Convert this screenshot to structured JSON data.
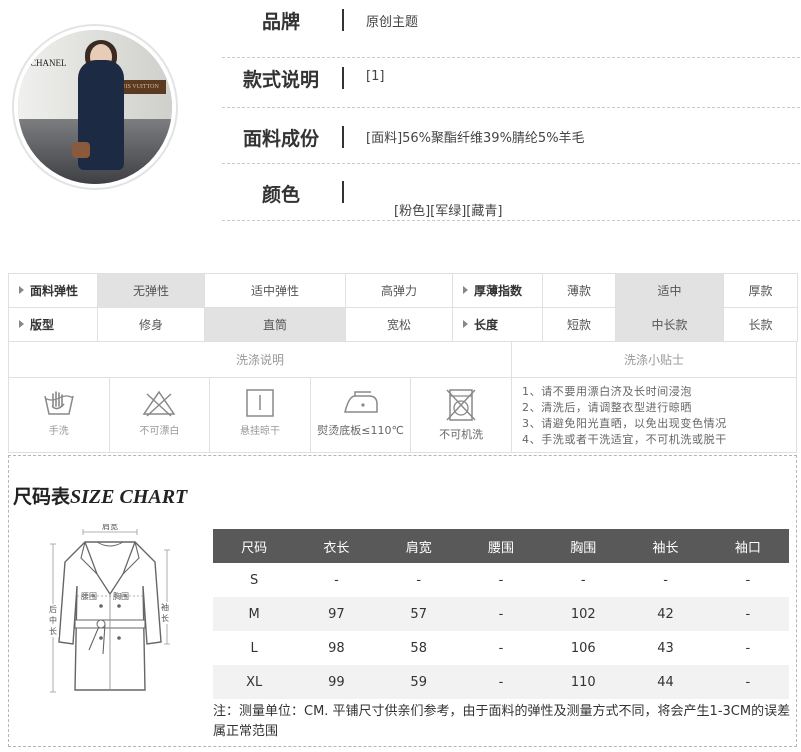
{
  "product": {
    "avatar_signs": [
      "CHANEL",
      "LOUIS VUITTON"
    ],
    "rows": [
      {
        "label": "品牌",
        "value": "原创主题"
      },
      {
        "label": "款式说明",
        "value": "[1]"
      },
      {
        "label": "面料成份",
        "value": "[面料]56%聚酯纤维39%腈纶5%羊毛"
      },
      {
        "label": "颜色",
        "value": "[粉色][军绿][藏青]"
      }
    ]
  },
  "attributes": {
    "rows": [
      {
        "group1": {
          "label": "面料弹性",
          "options": [
            "无弹性",
            "适中弹性",
            "高弹力"
          ],
          "selected": 0
        },
        "group2": {
          "label": "厚薄指数",
          "options": [
            "薄款",
            "适中",
            "厚款"
          ],
          "selected": 1
        }
      },
      {
        "group1": {
          "label": "版型",
          "options": [
            "修身",
            "直筒",
            "宽松"
          ],
          "selected": 1
        },
        "group2": {
          "label": "长度",
          "options": [
            "短款",
            "中长款",
            "长款"
          ],
          "selected": 1
        }
      }
    ]
  },
  "washing": {
    "title": "洗涤说明",
    "tips_title": "洗涤小贴士",
    "icons": [
      {
        "icon": "hand-wash-icon",
        "label": "手洗"
      },
      {
        "icon": "no-bleach-icon",
        "label": "不可漂白"
      },
      {
        "icon": "hang-dry-icon",
        "label": "悬挂晾干"
      },
      {
        "icon": "iron-icon",
        "label": "熨烫底板≤110℃"
      },
      {
        "icon": "no-machine-wash-icon",
        "label": "不可机洗"
      }
    ],
    "tips": [
      "1、请不要用漂白济及长时间浸泡",
      "2、清洗后，请调整衣型进行晾晒",
      "3、请避免阳光直晒，以免出现变色情况",
      "4、手洗或者干洗适宜，不可机洗或脱干"
    ]
  },
  "size_chart": {
    "title_cn": "尺码表",
    "title_en": "SIZE CHART",
    "diagram_labels": {
      "shoulder": "肩宽",
      "chest": "胸围",
      "waist": "腰围",
      "length_left": "后中长",
      "sleeve_right": "袖长"
    },
    "headers": [
      "尺码",
      "衣长",
      "肩宽",
      "腰围",
      "胸围",
      "袖长",
      "袖口"
    ],
    "rows": [
      [
        "S",
        "-",
        "-",
        "-",
        "-",
        "-",
        "-"
      ],
      [
        "M",
        "97",
        "57",
        "-",
        "102",
        "42",
        "-"
      ],
      [
        "L",
        "98",
        "58",
        "-",
        "106",
        "43",
        "-"
      ],
      [
        "XL",
        "99",
        "59",
        "-",
        "110",
        "44",
        "-"
      ]
    ],
    "note": "注：测量单位：CM. 平铺尺寸供亲们参考，由于面料的弹性及测量方式不同，将会产生1-3CM的误差属正常范围"
  }
}
